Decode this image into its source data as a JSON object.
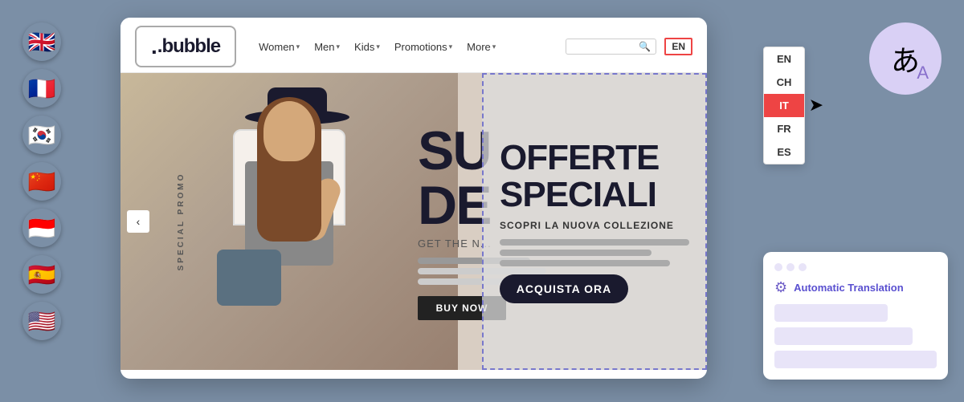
{
  "flags": [
    {
      "emoji": "🇬🇧",
      "lang": "en",
      "label": "English"
    },
    {
      "emoji": "🇫🇷",
      "lang": "fr",
      "label": "French"
    },
    {
      "emoji": "🇰🇷",
      "lang": "ko",
      "label": "Korean"
    },
    {
      "emoji": "🇨🇳",
      "lang": "zh",
      "label": "Chinese"
    },
    {
      "emoji": "🇮🇩",
      "lang": "id",
      "label": "Indonesian"
    },
    {
      "emoji": "🇪🇸",
      "lang": "es",
      "label": "Spanish"
    },
    {
      "emoji": "🇺🇸",
      "lang": "en-us",
      "label": "American English"
    }
  ],
  "browser": {
    "logo": ".bubble",
    "nav": {
      "items": [
        {
          "label": "Women",
          "hasDropdown": true
        },
        {
          "label": "Men",
          "hasDropdown": true
        },
        {
          "label": "Kids",
          "hasDropdown": true
        },
        {
          "label": "Promotions",
          "hasDropdown": true
        },
        {
          "label": "More",
          "hasDropdown": true
        }
      ],
      "searchPlaceholder": "",
      "langButton": "EN"
    }
  },
  "hero": {
    "verticalText": "SPECIAL PROMO",
    "bigTextLine1": "SU",
    "bigTextLine2": "DE",
    "subtitleEN": "GET THE N...",
    "buyNowBtn": "BUY NOW",
    "acquistaBtn": "ACQUISTA ORA"
  },
  "italianOverlay": {
    "line1": "OFFERTE",
    "line2": "SPECIALI",
    "subtitle": "SCOPRI LA NUOVA COLLEZIONE"
  },
  "langDropdown": {
    "options": [
      {
        "code": "EN",
        "active": false
      },
      {
        "code": "CH",
        "active": false
      },
      {
        "code": "IT",
        "active": true
      },
      {
        "code": "FR",
        "active": false
      },
      {
        "code": "ES",
        "active": false
      }
    ]
  },
  "translationCard": {
    "title": "Automatic Translation",
    "gearIcon": "⚙",
    "dots": [
      "#e8e4f8",
      "#e8e4f8",
      "#e8e4f8"
    ]
  },
  "translationBubble": {
    "icon": "あ"
  },
  "promotionsLink": "Promotions >"
}
